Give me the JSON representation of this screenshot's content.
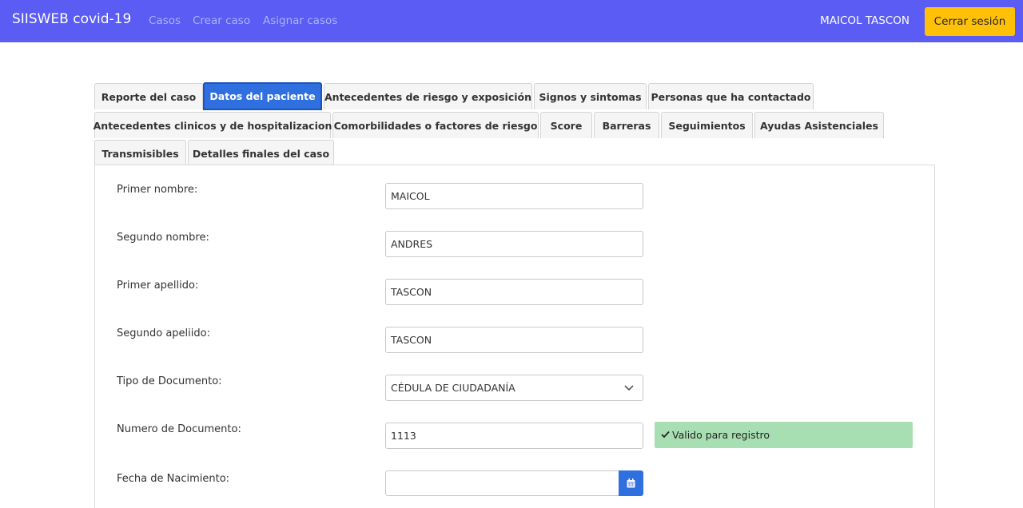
{
  "navbar": {
    "brand": "SIISWEB covid-19",
    "links": [
      "Casos",
      "Crear caso",
      "Asignar casos"
    ],
    "user": "MAICOL TASCON",
    "logout": "Cerrar sesión"
  },
  "tabs": [
    "Reporte del caso",
    "Datos del paciente",
    "Antecedentes de riesgo y exposición",
    "Signos y sintomas",
    "Personas que ha contactado",
    "Antecedentes clinicos y de hospitalizacion",
    "Comorbilidades o factores de riesgo",
    "Score",
    "Barreras",
    "Seguimientos",
    "Ayudas Asistenciales",
    "Transmisibles",
    "Detalles finales del caso"
  ],
  "active_tab": "Datos del paciente",
  "form": {
    "primer_nombre": {
      "label": "Primer nombre:",
      "value": "MAICOL"
    },
    "segundo_nombre": {
      "label": "Segundo nombre:",
      "value": "ANDRES"
    },
    "primer_apellido": {
      "label": "Primer apellido:",
      "value": "TASCON"
    },
    "segundo_apellido": {
      "label": "Segundo apeliido:",
      "value": "TASCON"
    },
    "tipo_documento": {
      "label": "Tipo de Documento:",
      "value": "CÉDULA DE CIUDADANÍA"
    },
    "numero_documento": {
      "label": "Numero de Documento:",
      "value": "1113",
      "status": "Valido para registro"
    },
    "fecha_nacimiento": {
      "label": "Fecha de Nacimiento:",
      "value": ""
    }
  },
  "icons": {
    "select": "chevron-down-icon",
    "valid": "check-icon",
    "date": "calendar-icon"
  },
  "colors": {
    "navbar": "#5a5cf4",
    "logout": "#ffc107",
    "active_tab": "#2f6fe0",
    "valid_badge": "#a8dfb2"
  }
}
